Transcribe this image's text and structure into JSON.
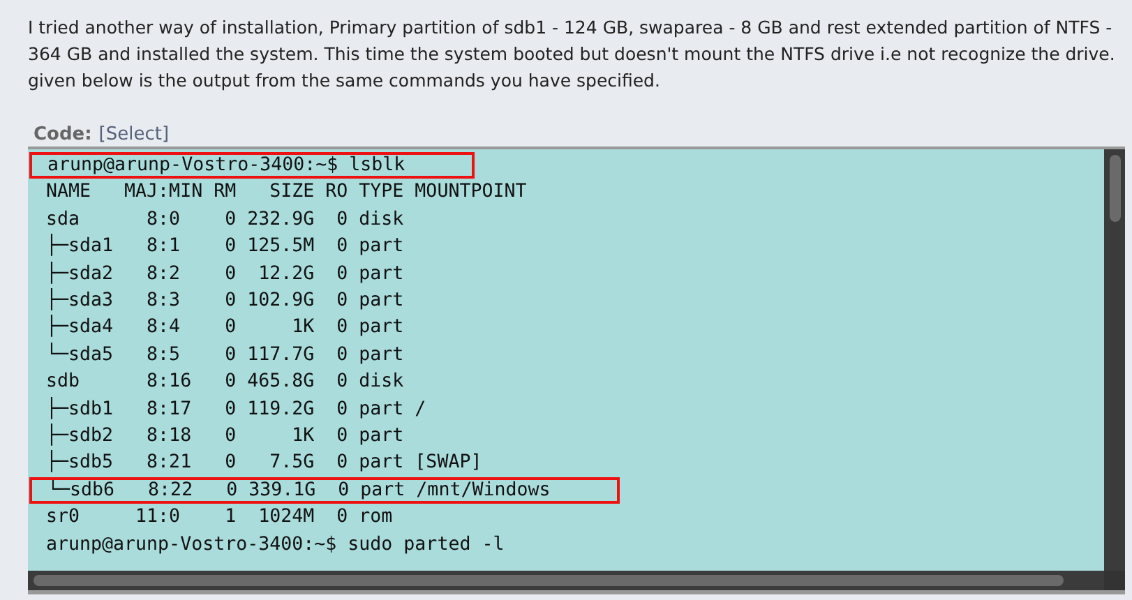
{
  "post": {
    "text": "I tried another way of installation, Primary partition of sdb1 - 124 GB, swaparea - 8 GB and rest extended partition of NTFS - 364 GB and installed the system. This time the system booted but doesn't mount the NTFS drive i.e not recognize the drive. given below is the output from the same commands you have specified."
  },
  "code": {
    "label": "Code:",
    "select_link": "[Select]",
    "lines": [
      {
        "text": "arunp@arunp-Vostro-3400:~$ lsblk",
        "boxed": true
      },
      {
        "text": "NAME   MAJ:MIN RM   SIZE RO TYPE MOUNTPOINT",
        "boxed": false
      },
      {
        "text": "sda      8:0    0 232.9G  0 disk",
        "boxed": false
      },
      {
        "text": "├─sda1   8:1    0 125.5M  0 part",
        "boxed": false
      },
      {
        "text": "├─sda2   8:2    0  12.2G  0 part",
        "boxed": false
      },
      {
        "text": "├─sda3   8:3    0 102.9G  0 part",
        "boxed": false
      },
      {
        "text": "├─sda4   8:4    0     1K  0 part",
        "boxed": false
      },
      {
        "text": "└─sda5   8:5    0 117.7G  0 part",
        "boxed": false
      },
      {
        "text": "sdb      8:16   0 465.8G  0 disk",
        "boxed": false
      },
      {
        "text": "├─sdb1   8:17   0 119.2G  0 part /",
        "boxed": false
      },
      {
        "text": "├─sdb2   8:18   0     1K  0 part",
        "boxed": false
      },
      {
        "text": "├─sdb5   8:21   0   7.5G  0 part [SWAP]",
        "boxed": false
      },
      {
        "text": "└─sdb6   8:22   0 339.1G  0 part /mnt/Windows",
        "boxed": true
      },
      {
        "text": "sr0     11:0    1  1024M  0 rom",
        "boxed": false
      },
      {
        "text": "arunp@arunp-Vostro-3400:~$ sudo parted -l",
        "boxed": false
      }
    ]
  }
}
